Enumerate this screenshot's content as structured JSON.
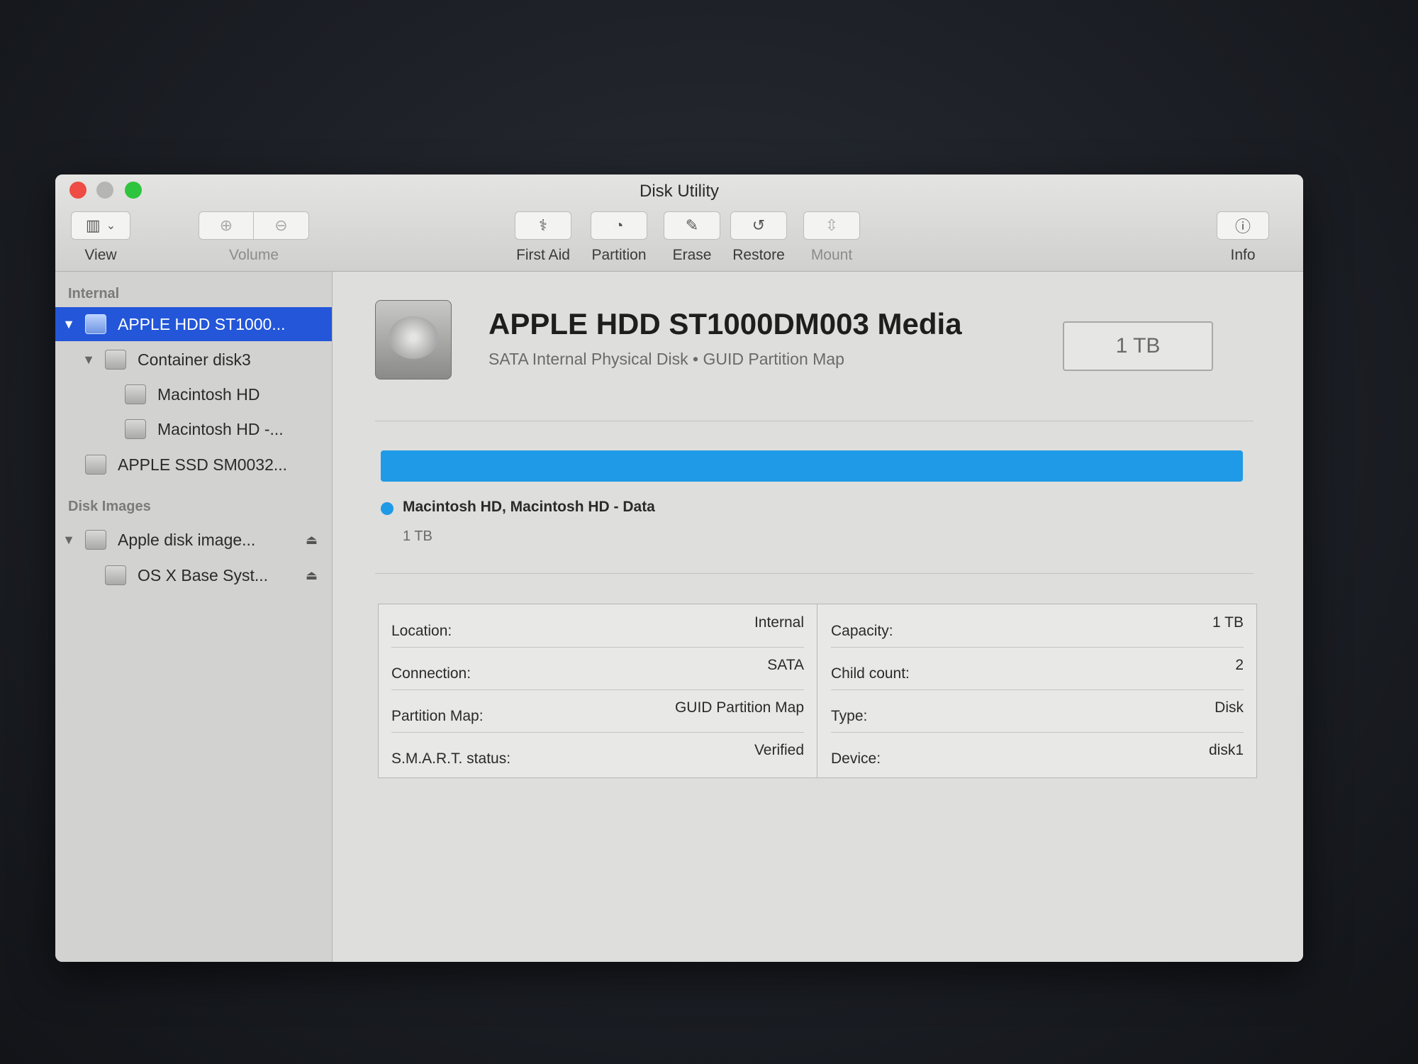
{
  "window": {
    "title": "Disk Utility"
  },
  "toolbar": {
    "view_label": "View",
    "volume_label": "Volume",
    "first_aid_label": "First Aid",
    "partition_label": "Partition",
    "erase_label": "Erase",
    "restore_label": "Restore",
    "mount_label": "Mount",
    "info_label": "Info"
  },
  "sidebar": {
    "internal_header": "Internal",
    "disk_images_header": "Disk Images",
    "items": [
      {
        "label": "APPLE HDD ST1000...",
        "selected": true
      },
      {
        "label": "Container disk3"
      },
      {
        "label": "Macintosh HD"
      },
      {
        "label": "Macintosh HD -..."
      },
      {
        "label": "APPLE SSD SM0032..."
      },
      {
        "label": "Apple disk image..."
      },
      {
        "label": "OS X Base Syst..."
      }
    ]
  },
  "disk": {
    "title": "APPLE HDD ST1000DM003 Media",
    "subtitle": "SATA Internal Physical Disk • GUID Partition Map",
    "size": "1 TB",
    "usage_fraction": 1.0,
    "usage_color": "#1f9ae6",
    "legend_name": "Macintosh HD, Macintosh HD - Data",
    "legend_size": "1 TB"
  },
  "info": {
    "left": [
      {
        "key": "Location:",
        "value": "Internal"
      },
      {
        "key": "Connection:",
        "value": "SATA"
      },
      {
        "key": "Partition Map:",
        "value": "GUID Partition Map"
      },
      {
        "key": "S.M.A.R.T. status:",
        "value": "Verified"
      }
    ],
    "right": [
      {
        "key": "Capacity:",
        "value": "1 TB"
      },
      {
        "key": "Child count:",
        "value": "2"
      },
      {
        "key": "Type:",
        "value": "Disk"
      },
      {
        "key": "Device:",
        "value": "disk1"
      }
    ]
  }
}
